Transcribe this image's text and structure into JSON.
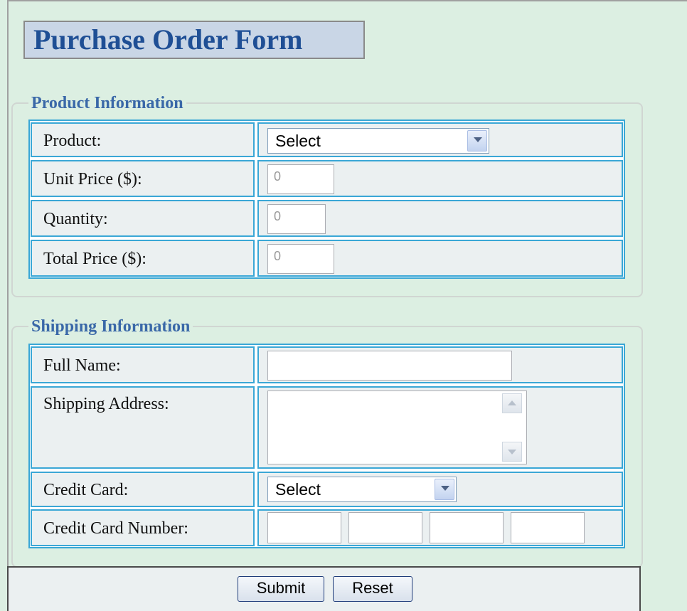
{
  "title": "Purchase Order Form",
  "product_section": {
    "legend": "Product Information",
    "product_label": "Product:",
    "product_value": "Select",
    "unit_price_label": "Unit Price ($):",
    "unit_price_value": "0",
    "quantity_label": "Quantity:",
    "quantity_value": "0",
    "total_price_label": "Total Price ($):",
    "total_price_value": "0"
  },
  "shipping_section": {
    "legend": "Shipping Information",
    "full_name_label": "Full Name:",
    "full_name_value": "",
    "address_label": "Shipping Address:",
    "address_value": "",
    "credit_card_label": "Credit Card:",
    "credit_card_value": "Select",
    "cc_number_label": "Credit Card Number:",
    "cc_number_parts": [
      "",
      "",
      "",
      ""
    ]
  },
  "buttons": {
    "submit": "Submit",
    "reset": "Reset"
  },
  "colors": {
    "page_bg": "#dcefe2",
    "title_text": "#1f4f95",
    "legend_text": "#3a68a8",
    "table_border": "#3aa7d6",
    "cell_bg": "#ebf0f1"
  }
}
